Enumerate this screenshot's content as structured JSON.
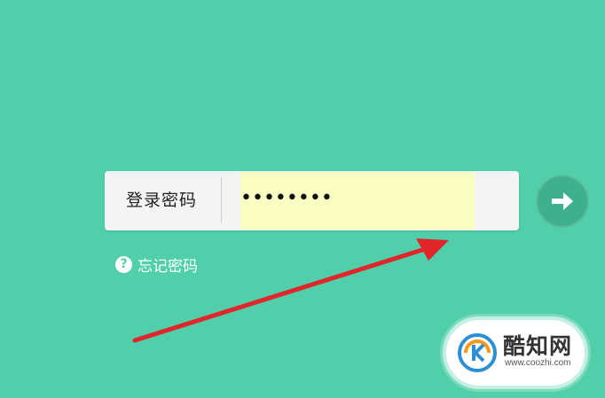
{
  "login": {
    "field_label": "登录密码",
    "password_value": "••••••••",
    "input_highlight_color": "#fbffc2"
  },
  "submit": {
    "icon": "arrow-right-icon"
  },
  "forgot": {
    "icon": "question-circle-icon",
    "label": "忘记密码"
  },
  "annotation": {
    "icon": "red-arrow-icon",
    "color": "#e0262b"
  },
  "watermark": {
    "name": "酷知网",
    "url": "www.coozhi.com"
  },
  "theme": {
    "background": "#50cfaa",
    "button": "#3fb08d"
  }
}
